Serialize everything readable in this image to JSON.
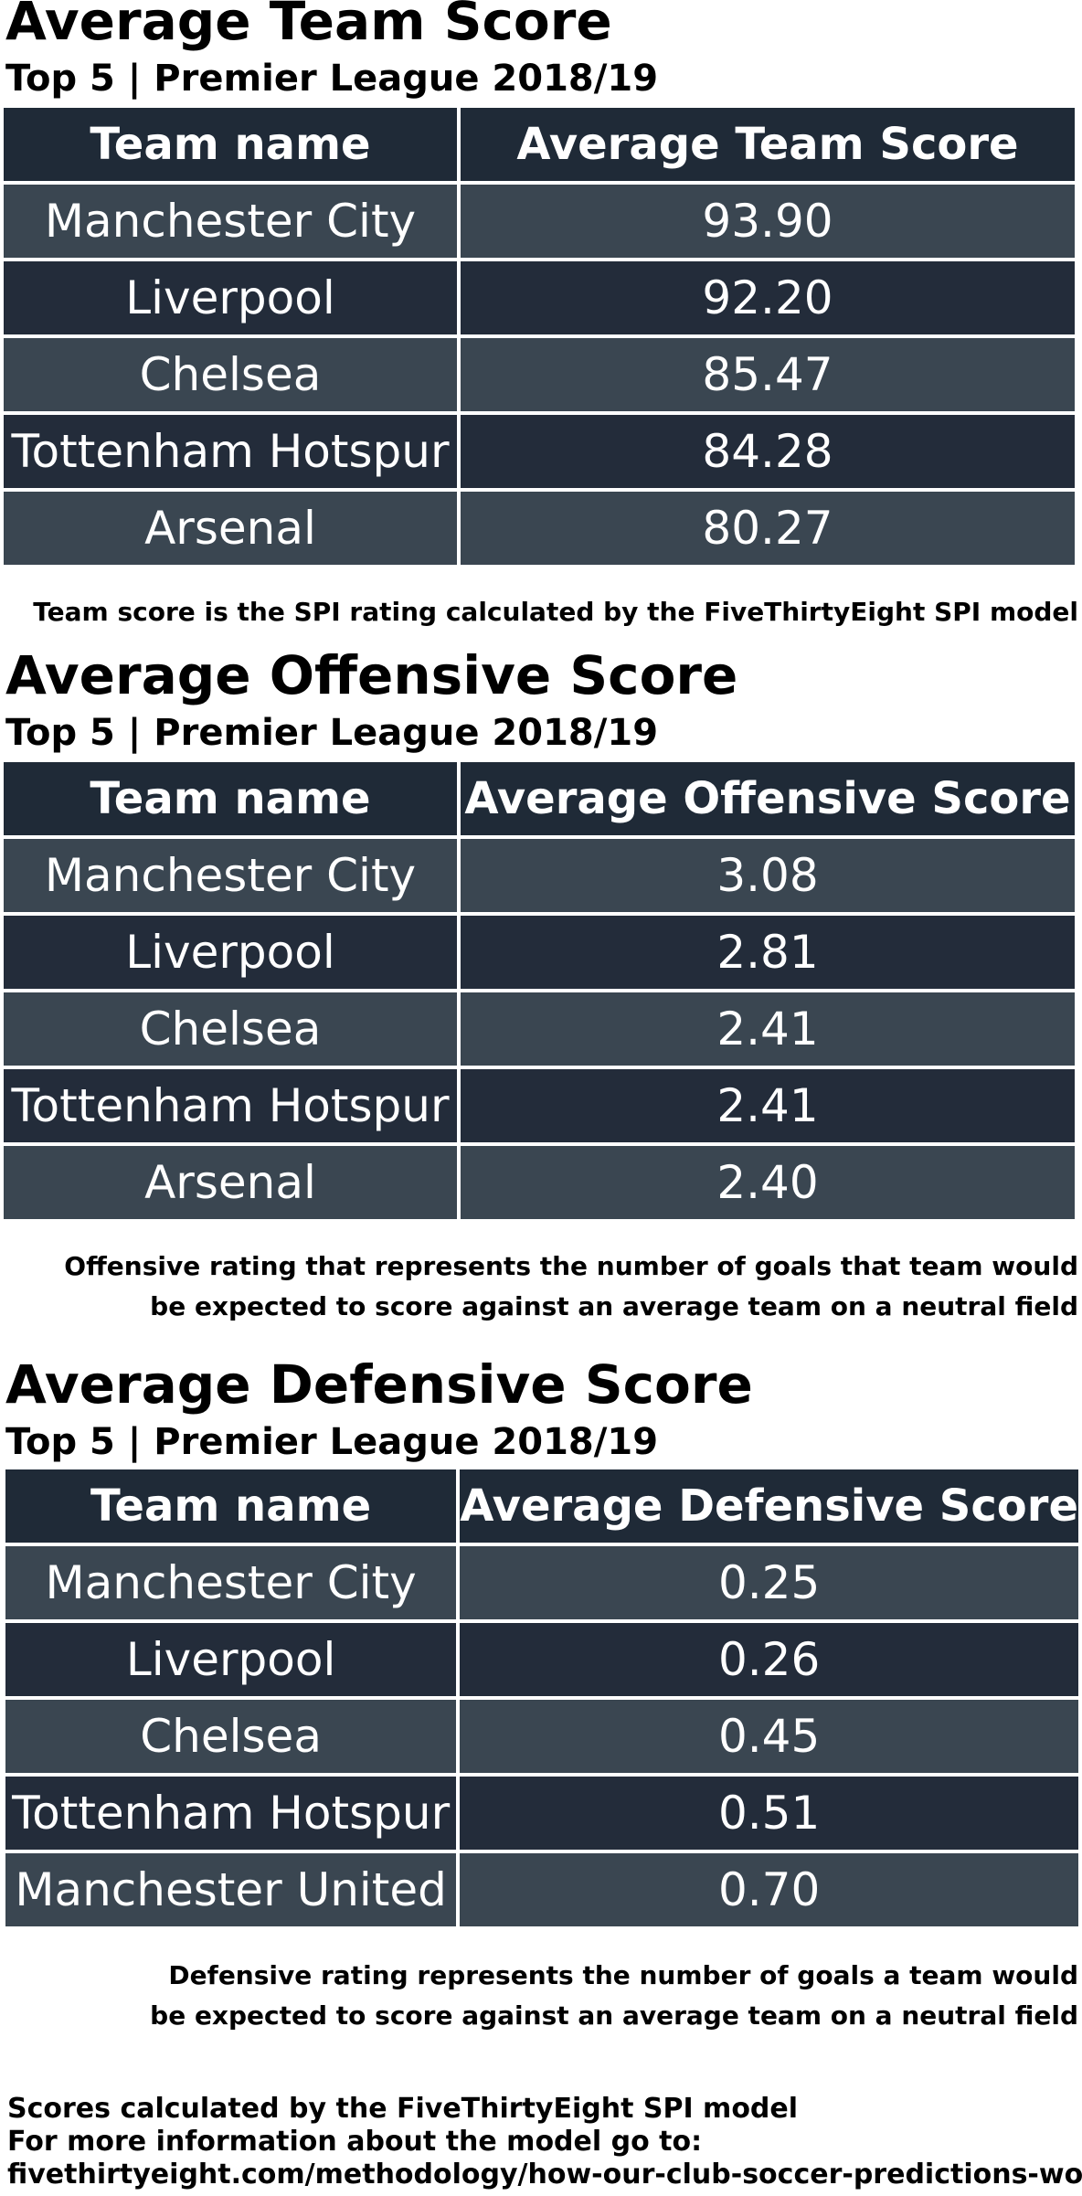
{
  "colors": {
    "header_bg": "#1f2a37",
    "row_light": "#3a4651",
    "row_dark": "#232c3a",
    "text_on_dark": "#ffffff"
  },
  "chart_data": [
    {
      "type": "table",
      "title": "Average Team Score",
      "subtitle": "Top 5 | Premier League 2018/19",
      "columns": [
        "Team name",
        "Average Team Score"
      ],
      "rows": [
        [
          "Manchester City",
          "93.90"
        ],
        [
          "Liverpool",
          "92.20"
        ],
        [
          "Chelsea",
          "85.47"
        ],
        [
          "Tottenham Hotspur",
          "84.28"
        ],
        [
          "Arsenal",
          "80.27"
        ]
      ],
      "note": [
        "Team score is the SPI rating calculated by the FiveThirtyEight SPI model"
      ]
    },
    {
      "type": "table",
      "title": "Average Offensive Score",
      "subtitle": "Top 5 | Premier League 2018/19",
      "columns": [
        "Team name",
        "Average Offensive Score"
      ],
      "rows": [
        [
          "Manchester City",
          "3.08"
        ],
        [
          "Liverpool",
          "2.81"
        ],
        [
          "Chelsea",
          "2.41"
        ],
        [
          "Tottenham Hotspur",
          "2.41"
        ],
        [
          "Arsenal",
          "2.40"
        ]
      ],
      "note": [
        "Offensive rating that represents the number of goals that team would",
        "be expected to score against an average team on a neutral field"
      ]
    },
    {
      "type": "table",
      "title": "Average Defensive Score",
      "subtitle": "Top 5 | Premier League 2018/19",
      "columns": [
        "Team name",
        "Average Defensive Score"
      ],
      "rows": [
        [
          "Manchester City",
          "0.25"
        ],
        [
          "Liverpool",
          "0.26"
        ],
        [
          "Chelsea",
          "0.45"
        ],
        [
          "Tottenham Hotspur",
          "0.51"
        ],
        [
          "Manchester United",
          "0.70"
        ]
      ],
      "note": [
        "Defensive rating represents the number of goals a team would",
        "be expected to score against an average team on a neutral field"
      ]
    }
  ],
  "footer": [
    "Scores calculated by the FiveThirtyEight SPI model",
    "For more information about the model go to:",
    "fivethirtyeight.com/methodology/how-our-club-soccer-predictions-work/"
  ]
}
